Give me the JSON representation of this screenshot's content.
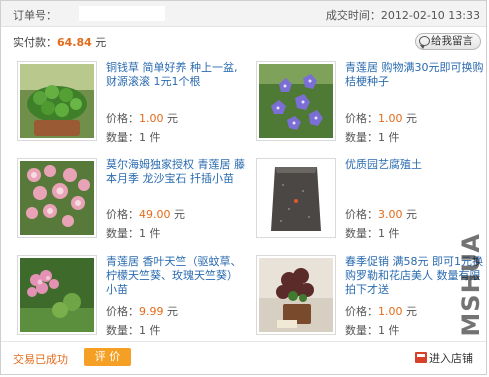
{
  "header": {
    "order_label": "订单号：",
    "deal_time_label": "成交时间：",
    "deal_time": "2012-02-10  13:33"
  },
  "payment": {
    "label": "实付款：",
    "amount": "64.84",
    "unit": "元"
  },
  "message_button": {
    "label": "给我留言",
    "icon": "speech-bubble-icon"
  },
  "products": [
    {
      "title": "铜钱草  简单好养  种上一盆,财源滚滚  1元1个根",
      "price_label": "价格：",
      "price": "1.00",
      "price_unit": "元",
      "qty_label": "数量：",
      "qty": "1 件",
      "image": "pennywort-plant-photo"
    },
    {
      "title": "青莲居  购物满30元即可换购  桔梗种子",
      "price_label": "价格：",
      "price": "1.00",
      "price_unit": "元",
      "qty_label": "数量：",
      "qty": "1 件",
      "image": "balloon-flower-photo"
    },
    {
      "title": "莫尔海姆独家授权  青莲居  藤本月季  龙沙宝石  扦插小苗",
      "price_label": "价格：",
      "price": "49.00",
      "price_unit": "元",
      "qty_label": "数量：",
      "qty": "1 件",
      "image": "climbing-rose-photo"
    },
    {
      "title": "优质园艺腐殖土",
      "price_label": "价格：",
      "price": "3.00",
      "price_unit": "元",
      "qty_label": "数量：",
      "qty": "1 件",
      "image": "humus-soil-bag-photo"
    },
    {
      "title": "青莲居  香叶天竺（驱蚊草、柠檬天竺葵、玫瑰天竺葵）小苗",
      "price_label": "价格：",
      "price": "9.99",
      "price_unit": "元",
      "qty_label": "数量：",
      "qty": "1 件",
      "image": "geranium-photo"
    },
    {
      "title": "春季促销  满58元  即可1元换购罗勒和花店美人  数量有限  拍下才送",
      "price_label": "价格：",
      "price": "1.00",
      "price_unit": "元",
      "qty_label": "数量：",
      "qty": "1 件",
      "image": "potted-plant-photo"
    }
  ],
  "footer": {
    "status": "交易已成功",
    "review_button": "评 价",
    "store_link": "进入店铺",
    "store_icon": "store-icon"
  },
  "watermark": "MSHUA"
}
